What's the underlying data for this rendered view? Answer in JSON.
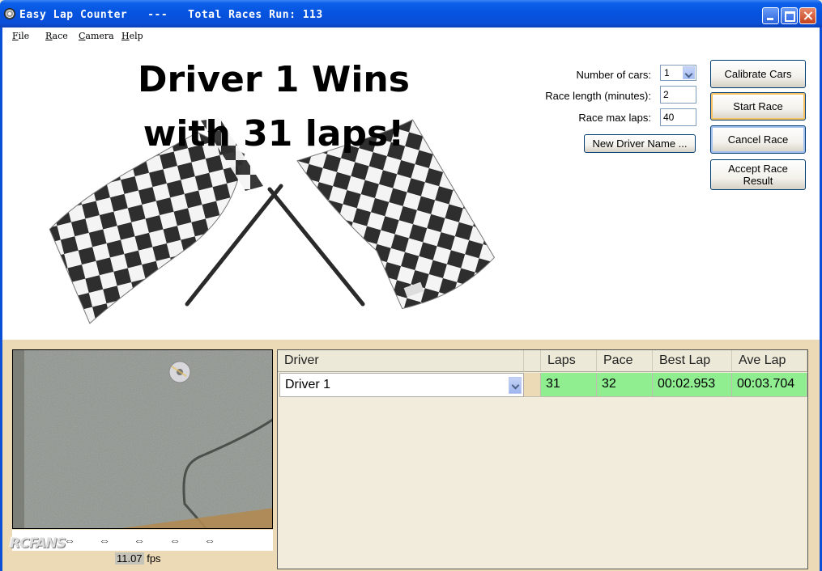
{
  "window": {
    "title": "Easy Lap Counter   ---   Total Races Run: 113",
    "icon": "app-disc-icon"
  },
  "menu": {
    "items": [
      {
        "label": "File",
        "accel": "F"
      },
      {
        "label": "Race",
        "accel": "R"
      },
      {
        "label": "Camera",
        "accel": "C"
      },
      {
        "label": "Help",
        "accel": "H"
      }
    ]
  },
  "banner": {
    "line1": "Driver 1 Wins",
    "line2": "with 31 laps!",
    "image": "checkered-flags"
  },
  "settings": {
    "cars_label": "Number of cars:",
    "cars_value": "1",
    "length_label": "Race length (minutes):",
    "length_value": "2",
    "max_laps_label": "Race max laps:",
    "max_laps_value": "40",
    "new_driver_label": "New Driver Name ..."
  },
  "actions": {
    "calibrate": "Calibrate Cars",
    "start": "Start Race",
    "cancel": "Cancel Race",
    "accept_line1": "Accept Race",
    "accept_line2": "Result"
  },
  "camera": {
    "fps_value": "11.07",
    "fps_unit": "fps",
    "arrows": [
      "⇔",
      "⇔",
      "⇔",
      "⇔",
      "⇔"
    ],
    "watermark": "RCFANS"
  },
  "grid": {
    "columns": [
      "Driver",
      "Laps",
      "Pace",
      "Best Lap",
      "Ave Lap"
    ],
    "rows": [
      {
        "driver": "Driver 1",
        "laps": "31",
        "pace": "32",
        "best_lap": "00:02.953",
        "ave_lap": "00:03.704"
      }
    ],
    "highlight_color": "#90ee90"
  },
  "colors": {
    "titlebar": "#0553df",
    "panel": "#ecd9b6",
    "grid_bg": "#f1ecdc"
  }
}
